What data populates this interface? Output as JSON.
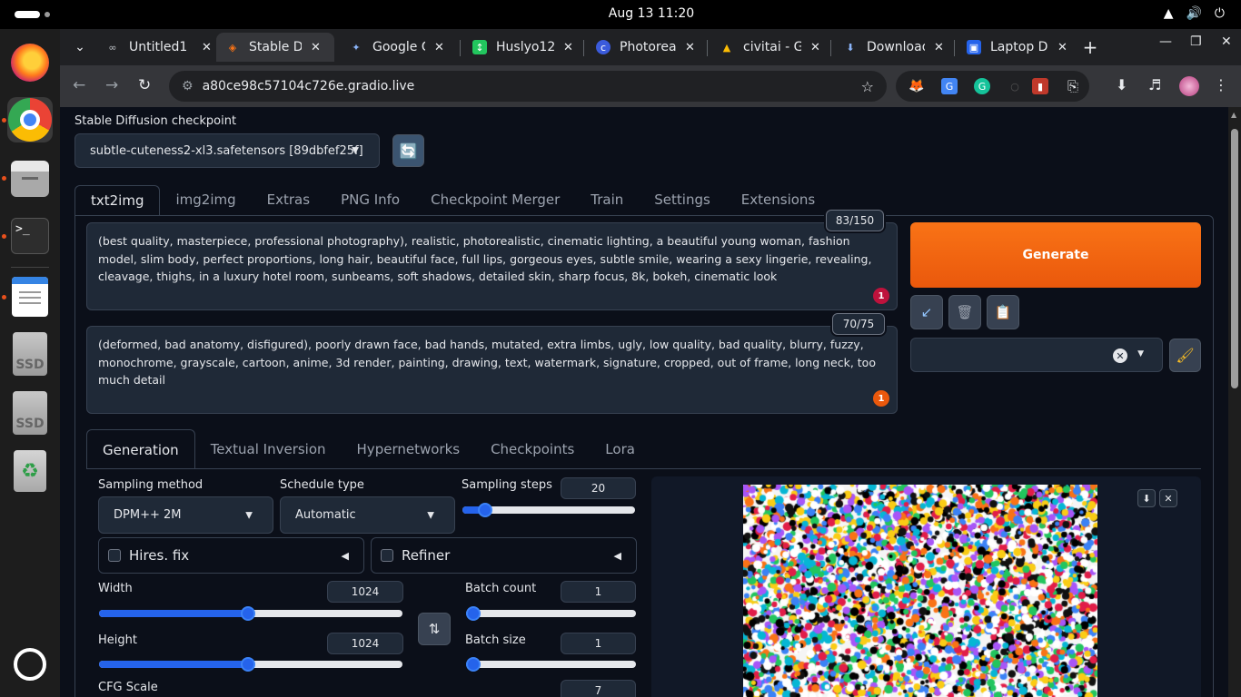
{
  "system": {
    "clock": "Aug 13  11:20"
  },
  "dock": {
    "items": [
      "Firefox",
      "Chrome",
      "Files",
      "Terminal",
      "Text Editor",
      "SSD",
      "SSD",
      "Trash",
      "Show Apps"
    ],
    "ssd_label": "SSD",
    "terminal_glyph": ">_"
  },
  "browser": {
    "tabs": [
      {
        "title": "Untitled1",
        "favicon": "link-icon",
        "active": false
      },
      {
        "title": "Stable Diffusion",
        "favicon": "gradio-icon",
        "active": true
      },
      {
        "title": "Google Gemini",
        "favicon": "gemini-icon",
        "active": false
      },
      {
        "title": "Huslyo12",
        "favicon": "sheets-icon",
        "active": false
      },
      {
        "title": "Photorealistic",
        "favicon": "c-icon",
        "active": false
      },
      {
        "title": "civitai - Google Drive",
        "favicon": "drive-icon",
        "active": false
      },
      {
        "title": "Download",
        "favicon": "download-icon",
        "active": false
      },
      {
        "title": "Laptop D",
        "favicon": "laptop-icon",
        "active": false
      }
    ],
    "url": "a80ce98c57104c726e.gradio.live"
  },
  "app": {
    "checkpoint_label": "Stable Diffusion checkpoint",
    "checkpoint_value": "subtle-cuteness2-xl3.safetensors [89dbfef25f]",
    "main_tabs": [
      "txt2img",
      "img2img",
      "Extras",
      "PNG Info",
      "Checkpoint Merger",
      "Train",
      "Settings",
      "Extensions"
    ],
    "prompt": {
      "text": "(best quality, masterpiece, professional photography), realistic, photorealistic, cinematic lighting, a beautiful young woman, fashion model, slim body, perfect proportions, long hair, beautiful face, full lips, gorgeous eyes, subtle smile, wearing a sexy lingerie, revealing, cleavage, thighs, in a luxury hotel room, sunbeams, soft shadows, detailed skin, sharp focus, 8k, bokeh, cinematic look",
      "counter": "83/150",
      "badge": "1"
    },
    "negative_prompt": {
      "text": "(deformed, bad anatomy, disfigured), poorly drawn face, bad hands, mutated, extra limbs, ugly, low quality, bad quality, blurry, fuzzy, monochrome, grayscale, cartoon, anime, 3d render, painting, drawing, text, watermark, signature, cropped, out of frame, long neck, too much detail",
      "counter": "70/75",
      "badge": "1"
    },
    "generate_label": "Generate",
    "sub_tabs": [
      "Generation",
      "Textual Inversion",
      "Hypernetworks",
      "Checkpoints",
      "Lora"
    ],
    "sampling_method": {
      "label": "Sampling method",
      "value": "DPM++ 2M"
    },
    "schedule_type": {
      "label": "Schedule type",
      "value": "Automatic"
    },
    "sampling_steps": {
      "label": "Sampling steps",
      "value": "20",
      "fraction": 0.13
    },
    "hires_fix_label": "Hires. fix",
    "refiner_label": "Refiner",
    "width": {
      "label": "Width",
      "value": "1024",
      "fraction": 0.49
    },
    "height": {
      "label": "Height",
      "value": "1024",
      "fraction": 0.49
    },
    "batch_count": {
      "label": "Batch count",
      "value": "1",
      "fraction": 0.0
    },
    "batch_size": {
      "label": "Batch size",
      "value": "1",
      "fraction": 0.0
    },
    "cfg_scale": {
      "label": "CFG Scale",
      "value": "7"
    },
    "colors": {
      "accent": "#2563eb",
      "generate": "#ea580c",
      "background": "#0b0f19"
    }
  }
}
